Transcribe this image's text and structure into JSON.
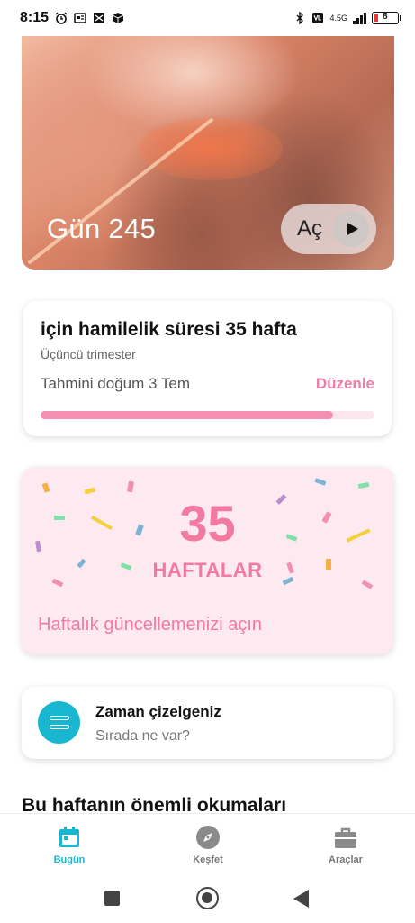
{
  "status_bar": {
    "time": "8:15",
    "network": "4.5G",
    "battery": "8"
  },
  "hero": {
    "title": "Gün 245",
    "play_label": "Aç"
  },
  "pregnancy": {
    "title": "için hamilelik süresi 35 hafta",
    "trimester": "Üçüncü trimester",
    "due_date": "Tahmini doğum 3 Tem",
    "edit_label": "Düzenle",
    "progress_fraction": 0.875,
    "colors": {
      "accent": "#ef7fa3",
      "track": "#fce6ee",
      "fill": "#f48fb1"
    }
  },
  "week": {
    "number": "35",
    "label": "HAFTALAR",
    "cta": "Haftalık güncellemenizi açın",
    "colors": {
      "background": "#fdeaf0",
      "text": "#f27aa0"
    }
  },
  "timeline": {
    "title": "Zaman çizelgeniz",
    "subtitle": "Sırada ne var?",
    "icon": "timeline-icon",
    "colors": {
      "icon_bg": "#19b7cf"
    }
  },
  "section": {
    "title": "Bu haftanın önemli okumaları"
  },
  "bottom_nav": {
    "items": [
      {
        "label": "Bugün",
        "icon": "calendar-icon",
        "active": true
      },
      {
        "label": "Keşfet",
        "icon": "compass-icon",
        "active": false
      },
      {
        "label": "Araçlar",
        "icon": "briefcase-icon",
        "active": false
      }
    ]
  }
}
